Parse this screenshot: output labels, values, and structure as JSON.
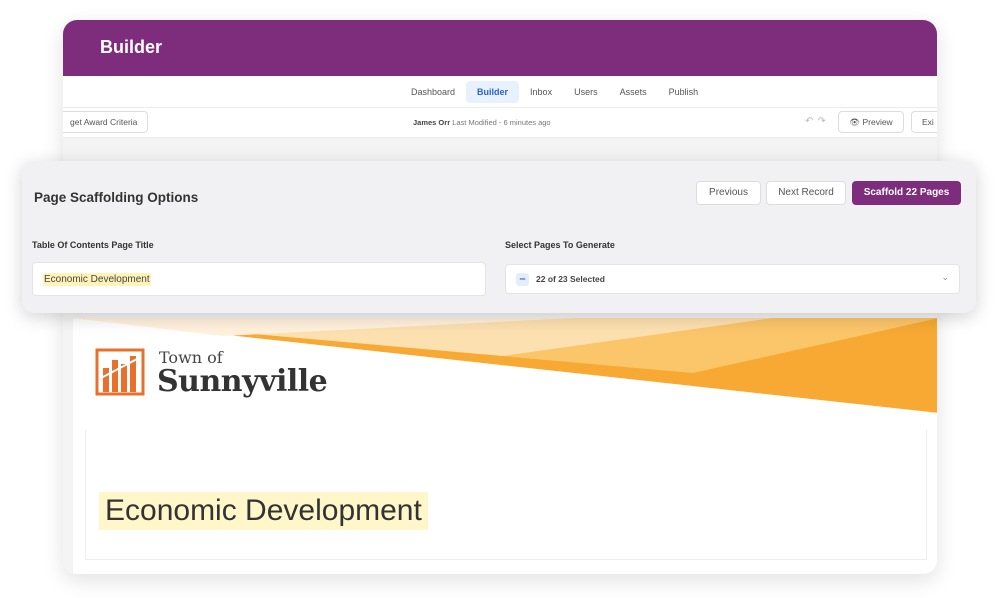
{
  "app": {
    "title": "Builder"
  },
  "nav": {
    "tabs": [
      {
        "label": "Dashboard"
      },
      {
        "label": "Builder"
      },
      {
        "label": "Inbox"
      },
      {
        "label": "Users"
      },
      {
        "label": "Assets"
      },
      {
        "label": "Publish"
      }
    ]
  },
  "toolbar": {
    "award_button": "get Award Criteria",
    "modified_user": "James Orr",
    "modified_text": "Last Modified - 6 minutes ago",
    "preview_label": "Preview",
    "exit_label": "Exi"
  },
  "modal": {
    "title": "Page Scaffolding Options",
    "previous_label": "Previous",
    "next_label": "Next Record",
    "scaffold_label": "Scaffold 22 Pages",
    "toc_label": "Table Of Contents Page Title",
    "toc_value": "Economic Development",
    "pages_label": "Select Pages To Generate",
    "pages_value": "22 of 23 Selected"
  },
  "document": {
    "town_of": "Town of",
    "town_name": "Sunnyville",
    "heading": "Economic Development"
  },
  "colors": {
    "brand": "#7d2d7b",
    "highlight": "#fff3b8",
    "banner_orange": "#f7a933"
  }
}
